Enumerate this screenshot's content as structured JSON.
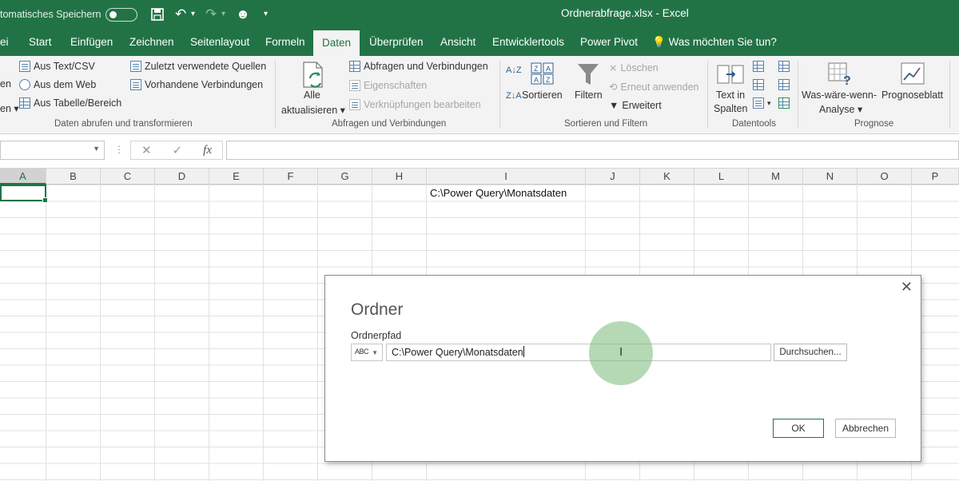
{
  "titlebar": {
    "autosave_label": "tomatisches Speichern",
    "document_title": "Ordnerabfrage.xlsx  -  Excel",
    "accent_color": "#217346"
  },
  "tabs": [
    {
      "label": "ei"
    },
    {
      "label": "Start"
    },
    {
      "label": "Einfügen"
    },
    {
      "label": "Zeichnen"
    },
    {
      "label": "Seitenlayout"
    },
    {
      "label": "Formeln"
    },
    {
      "label": "Daten",
      "active": true
    },
    {
      "label": "Überprüfen"
    },
    {
      "label": "Ansicht"
    },
    {
      "label": "Entwicklertools"
    },
    {
      "label": "Power Pivot"
    },
    {
      "label": "Was möchten Sie tun?"
    }
  ],
  "ribbon": {
    "get_data": {
      "cut_label_1": "en",
      "cut_label_2": "en ▾",
      "from_text": "Aus Text/CSV",
      "from_web": "Aus dem Web",
      "from_table": "Aus Tabelle/Bereich",
      "recent_sources": "Zuletzt verwendete Quellen",
      "existing_connections": "Vorhandene Verbindungen",
      "group_label": "Daten abrufen und transformieren"
    },
    "queries": {
      "refresh_all_1": "Alle",
      "refresh_all_2": "aktualisieren ▾",
      "queries_connections": "Abfragen und Verbindungen",
      "properties": "Eigenschaften",
      "edit_links": "Verknüpfungen bearbeiten",
      "group_label": "Abfragen und Verbindungen"
    },
    "sort_filter": {
      "sort": "Sortieren",
      "filter": "Filtern",
      "clear": "Löschen",
      "reapply": "Erneut anwenden",
      "advanced": "Erweitert",
      "group_label": "Sortieren und Filtern"
    },
    "data_tools": {
      "text_to_columns_1": "Text in",
      "text_to_columns_2": "Spalten",
      "group_label": "Datentools"
    },
    "forecast": {
      "what_if_1": "Was-wäre-wenn-",
      "what_if_2": "Analyse ▾",
      "forecast_sheet": "Prognoseblatt",
      "group_label": "Prognose"
    }
  },
  "formula_bar": {
    "fx": "fx",
    "cancel": "✕",
    "enter": "✓"
  },
  "columns": [
    "A",
    "B",
    "C",
    "D",
    "E",
    "F",
    "G",
    "H",
    "I",
    "J",
    "K",
    "L",
    "M",
    "N",
    "O",
    "P"
  ],
  "cells": {
    "I1": "C:\\Power Query\\Monatsdaten"
  },
  "dialog": {
    "title": "Ordner",
    "field_label": "Ordnerpfad",
    "type_abc": "ABC",
    "path_value": "C:\\Power Query\\Monatsdaten",
    "browse": "Durchsuchen...",
    "ok": "OK",
    "cancel": "Abbrechen"
  }
}
